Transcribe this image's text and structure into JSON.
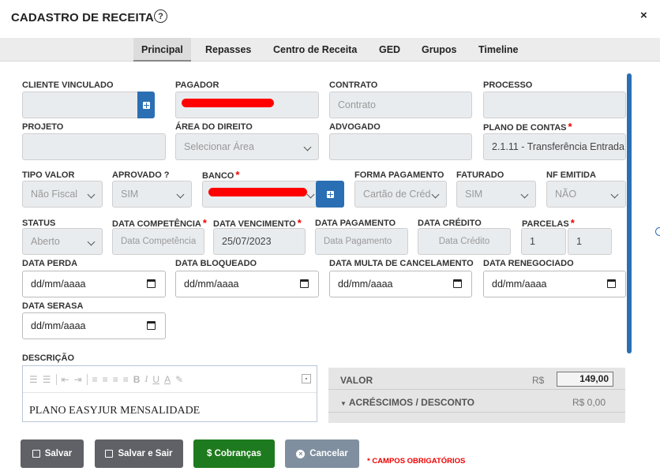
{
  "header": {
    "title": "CADASTRO DE RECEITA",
    "help_glyph": "?",
    "close_glyph": "×"
  },
  "tabs": [
    "Principal",
    "Repasses",
    "Centro de Receita",
    "GED",
    "Grupos",
    "Timeline"
  ],
  "active_tab": "Principal",
  "labels": {
    "cliente": "CLIENTE VINCULADO",
    "pagador": "PAGADOR",
    "contrato": "CONTRATO",
    "processo": "PROCESSO",
    "projeto": "PROJETO",
    "area": "ÁREA DO DIREITO",
    "advogado": "ADVOGADO",
    "plano": "PLANO DE CONTAS",
    "tipo_valor": "TIPO VALOR",
    "aprovado": "APROVADO ?",
    "banco": "BANCO",
    "forma_pagamento": "FORMA PAGAMENTO",
    "faturado": "FATURADO",
    "nf_emitida": "NF EMITIDA",
    "status": "STATUS",
    "data_competencia": "DATA COMPETÊNCIA",
    "data_vencimento": "DATA VENCIMENTO",
    "data_pagamento": "DATA PAGAMENTO",
    "data_credito": "DATA CRÉDITO",
    "parcelas": "PARCELAS",
    "data_perda": "DATA PERDA",
    "data_bloqueado": "DATA BLOQUEADO",
    "data_multa": "DATA MULTA DE CANCELAMENTO",
    "data_renegociado": "DATA RENEGOCIADO",
    "data_serasa": "DATA SERASA",
    "descricao": "DESCRIÇÃO"
  },
  "required_mark": "*",
  "fields": {
    "contrato_placeholder": "Contrato",
    "area_value": "Selecionar Área",
    "plano_value": "2.1.11 - Transferência Entrada",
    "tipo_valor_value": "Não Fiscal",
    "aprovado_value": "SIM",
    "forma_pagamento_value": "Cartão de Créd",
    "faturado_value": "SIM",
    "nf_emitida_value": "NÃO",
    "status_value": "Aberto",
    "data_competencia_placeholder": "Data Competência",
    "data_vencimento_value": "25/07/2023",
    "data_pagamento_placeholder": "Data Pagamento",
    "data_credito_placeholder": "Data Crédito",
    "parcela_atual": "1",
    "parcela_total": "1",
    "date_placeholder": "dd/mm/aaaa"
  },
  "editor": {
    "content": "PLANO EASYJUR MENSALIDADE",
    "toolbar": [
      "ordered-list-icon",
      "unordered-list-icon",
      "outdent-icon",
      "indent-icon",
      "align-left-icon",
      "align-center-icon",
      "align-right-icon",
      "justify-icon",
      "bold-icon",
      "italic-icon",
      "underline-icon",
      "font-color-icon",
      "highlight-icon",
      "fullscreen-icon"
    ]
  },
  "valor": {
    "label": "VALOR",
    "currency": "R$",
    "value": "149,00",
    "acrescimos_label": "ACRÉSCIMOS / DESCONTO",
    "acrescimos_value": "R$ 0,00"
  },
  "buttons": {
    "salvar": "Salvar",
    "salvar_sair": "Salvar e Sair",
    "cobrancas": "$ Cobranças",
    "cancelar": "Cancelar"
  },
  "required_note": "* CAMPOS OBRIGATÓRIOS",
  "colors": {
    "primary": "#2a6fb3",
    "salvar": "#5f6166",
    "cobrancas": "#1e7a1e",
    "cancelar": "#7f8f9f",
    "required": "#ee0000"
  }
}
